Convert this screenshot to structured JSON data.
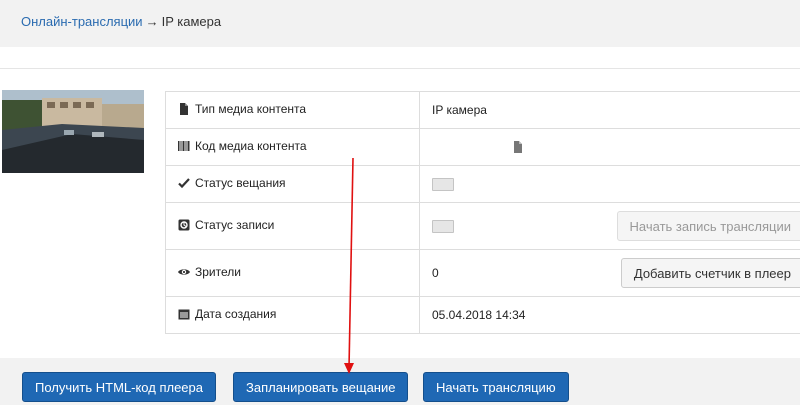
{
  "breadcrumb": {
    "parent": "Онлайн-трансляции",
    "separator": "→",
    "current": "IP камера"
  },
  "rows": [
    {
      "icon": "file-icon",
      "label": "Тип медиа контента",
      "value": "IP камера"
    },
    {
      "icon": "barcode-icon",
      "label": "Код медиа контента",
      "value": ""
    },
    {
      "icon": "check-icon",
      "label": "Статус вещания",
      "toggle": "off"
    },
    {
      "icon": "record-icon",
      "label": "Статус записи",
      "toggle": "off",
      "button": "Начать запись трансляции"
    },
    {
      "icon": "eye-icon",
      "label": "Зрители",
      "value": "0",
      "button": "Добавить счетчик в плеер"
    },
    {
      "icon": "calendar-icon",
      "label": "Дата создания",
      "value": "05.04.2018 14:34"
    }
  ],
  "actions": {
    "get_html": "Получить HTML-код плеера",
    "schedule": "Запланировать вещание",
    "start": "Начать трансляцию"
  },
  "colors": {
    "primary": "#1f68b4",
    "link": "#2a6bb0",
    "annotation_arrow": "#e01010"
  }
}
